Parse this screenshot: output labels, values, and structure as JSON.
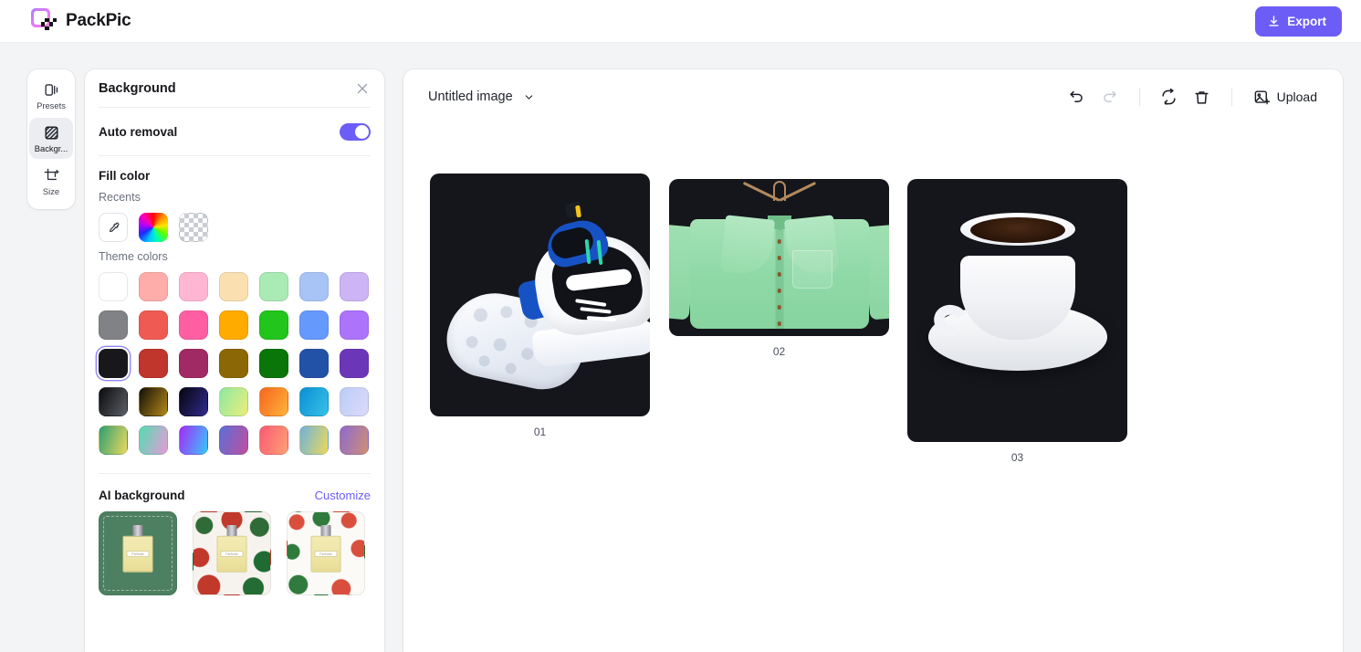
{
  "app": {
    "name": "PackPic",
    "logo_icon": "packpic-logo-icon"
  },
  "topbar": {
    "export_label": "Export",
    "export_icon": "download-icon",
    "export_color": "#6b5df6"
  },
  "rail": {
    "items": [
      {
        "label": "Presets",
        "icon": "presets-icon",
        "active": false
      },
      {
        "label": "Backgr...",
        "icon": "background-icon",
        "active": true
      },
      {
        "label": "Size",
        "icon": "size-icon",
        "active": false
      }
    ]
  },
  "panel": {
    "title": "Background",
    "close_icon": "close-icon",
    "auto_removal": {
      "label": "Auto removal",
      "state": "on"
    },
    "fill_color": {
      "title": "Fill color",
      "recents_label": "Recents",
      "recents": [
        {
          "name": "eyedropper",
          "icon": "eyedropper-icon"
        },
        {
          "name": "color-wheel",
          "color": "rainbow"
        },
        {
          "name": "transparent",
          "color": "transparent"
        }
      ],
      "theme_label": "Theme colors",
      "theme_rows": [
        [
          "#ffffff",
          "#ffadaa",
          "#ffb6d1",
          "#fae0b0",
          "#a9eab5",
          "#a8c4f6",
          "#cdb4f5"
        ],
        [
          "#808285",
          "#ef5b52",
          "#ff5fa2",
          "#ffab00",
          "#22c51b",
          "#6699fc",
          "#ad73fb"
        ],
        [
          "#17171c",
          "#c0352c",
          "#a02a63",
          "#8c6706",
          "#0a7508",
          "#2252a8",
          "#6b37b8"
        ],
        [
          "grad-black",
          "grad-olive",
          "grad-navy",
          "grad-greenyellow",
          "grad-orange",
          "grad-cyan",
          "grad-periwinkle"
        ],
        [
          "grad-green-yellow",
          "grad-mint-pink",
          "grad-violet-cyan",
          "grad-purple-magenta",
          "grad-pink-coral",
          "grad-blue-yellow",
          "grad-purple-orange"
        ]
      ],
      "selected": {
        "row": 2,
        "index": 0,
        "color": "#17171c"
      }
    },
    "ai_background": {
      "title": "AI background",
      "customize_label": "Customize",
      "customize_color": "#6b5df6",
      "thumbnails": [
        {
          "name": "green-studio-background",
          "product_label": "Perfume"
        },
        {
          "name": "christmas-wreath-background",
          "product_label": "Perfume"
        },
        {
          "name": "holly-candycane-background",
          "product_label": "Perfume"
        }
      ]
    }
  },
  "canvas": {
    "document_name": "Untitled image",
    "dropdown_icon": "chevron-down-icon",
    "tools": [
      {
        "name": "undo",
        "icon": "undo-icon",
        "disabled": false
      },
      {
        "name": "redo",
        "icon": "redo-icon",
        "disabled": true
      },
      {
        "name": "reset",
        "icon": "refresh-icon",
        "disabled": false
      },
      {
        "name": "delete",
        "icon": "trash-icon",
        "disabled": false
      }
    ],
    "upload_label": "Upload",
    "upload_icon": "image-add-icon",
    "images": [
      {
        "caption": "01",
        "subject": "sneakers",
        "background": "#15161c"
      },
      {
        "caption": "02",
        "subject": "green-shirt",
        "background": "#15161c"
      },
      {
        "caption": "03",
        "subject": "coffee-cup",
        "background": "#15161c"
      }
    ]
  }
}
